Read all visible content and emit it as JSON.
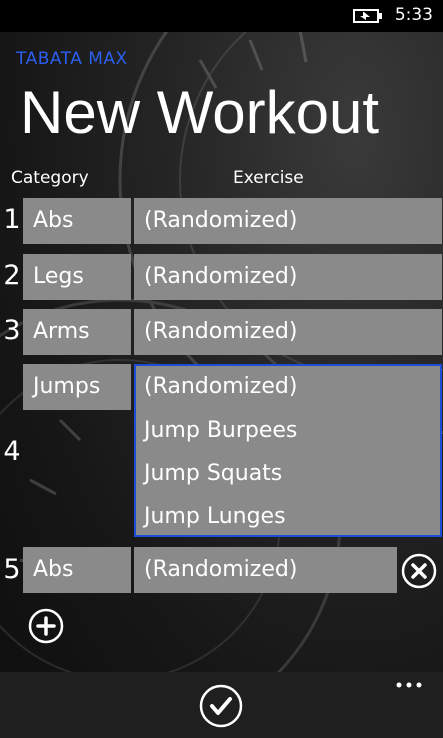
{
  "status": {
    "time": "5:33",
    "battery_icon": "battery-charging-icon"
  },
  "app": {
    "title": "TABATA MAX",
    "page_title": "New Workout",
    "accent": "#2a5ff0"
  },
  "columns": {
    "category": "Category",
    "exercise": "Exercise"
  },
  "rows": [
    {
      "num": "1",
      "category": "Abs",
      "exercise": "(Randomized)"
    },
    {
      "num": "2",
      "category": "Legs",
      "exercise": "(Randomized)"
    },
    {
      "num": "3",
      "category": "Arms",
      "exercise": "(Randomized)"
    },
    {
      "num": "4",
      "category": "Jumps",
      "exercise_options": [
        "(Randomized)",
        "Jump Burpees",
        "Jump Squats",
        "Jump Lunges"
      ]
    },
    {
      "num": "5",
      "category": "Abs",
      "exercise": "(Randomized)"
    }
  ],
  "icons": {
    "remove": "close-circle-icon",
    "add": "add-circle-icon",
    "confirm": "check-circle-icon",
    "more": "more-icon"
  }
}
